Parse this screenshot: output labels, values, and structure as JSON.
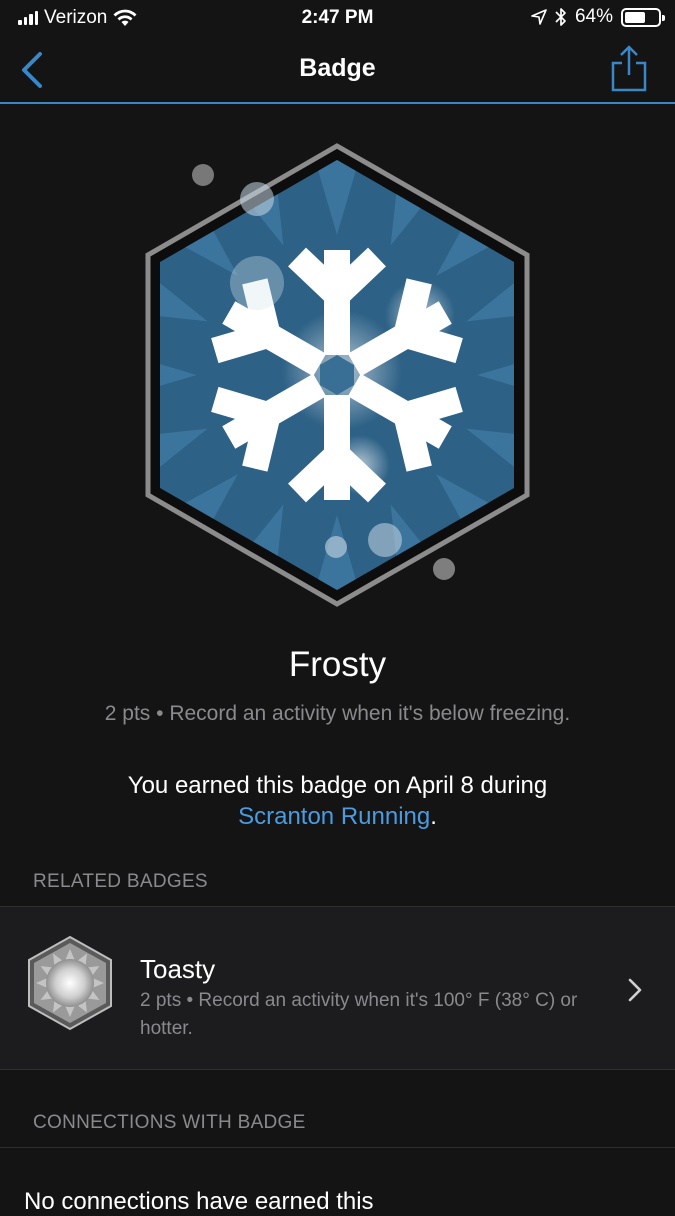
{
  "status_bar": {
    "carrier": "Verizon",
    "time": "2:47 PM",
    "battery": "64%",
    "battery_level": 0.64,
    "icons": [
      "signal-icon",
      "wifi-icon",
      "location-icon",
      "bluetooth-icon",
      "battery-icon"
    ]
  },
  "nav": {
    "title": "Badge",
    "back_icon": "chevron-left-icon",
    "share_icon": "share-icon",
    "accent": "#3a87c8"
  },
  "badge": {
    "name": "Frosty",
    "description": "2 pts • Record an activity when it's below freezing.",
    "earned_text": "You earned this badge on April 8 during",
    "earned_link": "Scranton Running",
    "earned_suffix": ".",
    "icon": "snowflake-badge-icon"
  },
  "related": {
    "header": "RELATED BADGES",
    "items": [
      {
        "name": "Toasty",
        "description": "2 pts • Record an activity when it's 100° F (38° C) or hotter.",
        "icon": "sun-badge-icon"
      }
    ]
  },
  "connections": {
    "header": "CONNECTIONS WITH BADGE",
    "text": "No connections have earned this"
  },
  "colors": {
    "background": "#141414",
    "link": "#4a9be0",
    "secondary_text": "#8a8a8e",
    "badge_blue": "#2d6186"
  }
}
